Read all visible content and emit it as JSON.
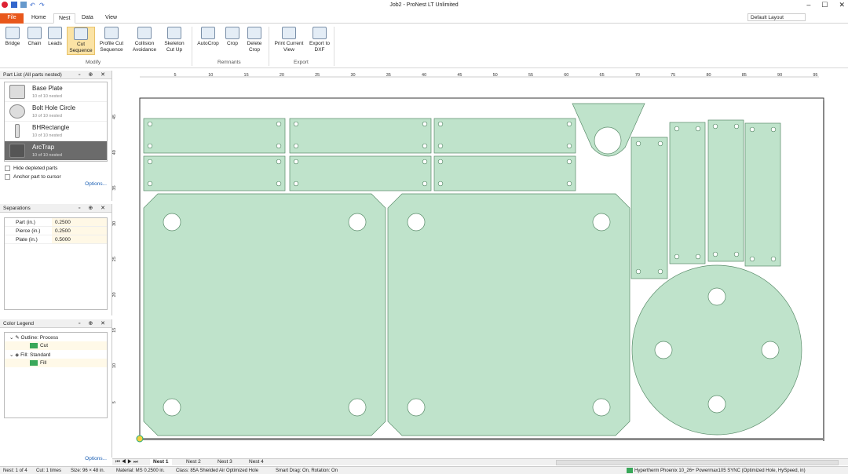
{
  "window": {
    "title": "Job2 - ProNest LT Unlimited",
    "controls": [
      "minimize-icon",
      "maximize-icon",
      "close-icon"
    ]
  },
  "tabs": [
    "File",
    "Home",
    "Nest",
    "Data",
    "View"
  ],
  "active_tab": "Nest",
  "layout_select": "Default Layout",
  "ribbon": {
    "buttons": [
      {
        "label": "Bridge",
        "icon": "bridge-icon"
      },
      {
        "label": "Chain",
        "icon": "chain-icon"
      },
      {
        "label": "Leads",
        "icon": "leads-icon"
      },
      {
        "label": "Cut Sequence",
        "icon": "cut-sequence-icon"
      },
      {
        "label": "Profile Cut Sequence",
        "icon": "profile-cut-sequence-icon"
      },
      {
        "label": "Collision Avoidance",
        "icon": "collision-avoidance-icon"
      },
      {
        "label": "Skeleton Cut Up",
        "icon": "skeleton-cut-up-icon"
      },
      {
        "label": "AutoCrop",
        "icon": "autocrop-icon"
      },
      {
        "label": "Crop",
        "icon": "crop-icon"
      },
      {
        "label": "Delete Crop",
        "icon": "delete-crop-icon"
      },
      {
        "label": "Print Current View",
        "icon": "print-icon"
      },
      {
        "label": "Export to DXF",
        "icon": "dxf-icon"
      }
    ],
    "groups": [
      "Modify",
      "Remnants",
      "Export"
    ]
  },
  "part_list": {
    "title": "Part List  (All parts nested)",
    "parts": [
      {
        "name": "Base Plate",
        "count": "10 of 10 nested"
      },
      {
        "name": "Bolt Hole Circle",
        "count": "10 of 10 nested"
      },
      {
        "name": "BHRectangle",
        "count": "10 of 10 nested"
      },
      {
        "name": "ArcTrap",
        "count": "10 of 10 nested"
      }
    ],
    "checkboxes": [
      "Hide depleted parts",
      "Anchor part to cursor"
    ],
    "options_link": "Options..."
  },
  "separations": {
    "title": "Separations",
    "rows": [
      {
        "label": "Part (in.)",
        "value": "0.2500"
      },
      {
        "label": "Pierce (in.)",
        "value": "0.2500"
      },
      {
        "label": "Plate (in.)",
        "value": "0.5000"
      }
    ]
  },
  "color_legend": {
    "title": "Color Legend",
    "rows": [
      {
        "label": "Outline: Process",
        "sub": "Cut"
      },
      {
        "label": "Fill: Standard",
        "sub": "Fill"
      }
    ],
    "options_link": "Options..."
  },
  "ruler": {
    "h_ticks": [
      "5",
      "10",
      "15",
      "20",
      "25",
      "30",
      "35",
      "40",
      "45",
      "50",
      "55",
      "60",
      "65",
      "70",
      "75",
      "80",
      "85",
      "90",
      "95"
    ],
    "v_ticks": [
      "45",
      "40",
      "35",
      "30",
      "25",
      "20",
      "15",
      "10",
      "5"
    ]
  },
  "nest_tabs": [
    "Nest 1",
    "Nest 2",
    "Nest 3",
    "Nest 4"
  ],
  "status": {
    "nest": "Nest: 1 of 4",
    "cut": "Cut: 1 times",
    "size": "Size: 96 × 48 in.",
    "material": "Material: MS 0.2500 in.",
    "class": "Class: 85A Shielded Air Optimized Hole",
    "smart_drag": "Smart Drag: On, Rotation: On",
    "machine": "Hypertherm Phoenix 10_26+ Powermax105 SYNC (Optimized Hole, HySpeed, in)"
  },
  "colors": {
    "part_fill": "#bfe3cb",
    "part_stroke": "#5a8c6a",
    "file_tab": "#e8571b",
    "selected_part": "#6b6b6b"
  }
}
